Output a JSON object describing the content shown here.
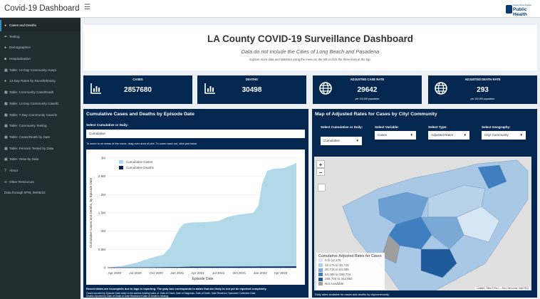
{
  "app": {
    "title": "Covid-19 Dashboard",
    "menu_icon": "hamburger-icon",
    "logo_top": "County of Los Angeles",
    "logo_main": "Public Health"
  },
  "sidebar": {
    "items": [
      {
        "label": "Cases and Deaths",
        "icon": "dashboard-icon"
      },
      {
        "label": "Testing",
        "icon": "syringe-icon"
      },
      {
        "label": "Demographics",
        "icon": "users-icon"
      },
      {
        "label": "Hospitalization",
        "icon": "hospital-icon"
      },
      {
        "label": "Table: 14-Day Community Hospi",
        "icon": "table-icon"
      },
      {
        "label": "14-Day Rates by Race/Ethnicity",
        "icon": "users-icon"
      },
      {
        "label": "Table: Community Case/Death",
        "icon": "table-icon"
      },
      {
        "label": "Table: 14-Day Community Case/D",
        "icon": "table-icon"
      },
      {
        "label": "Table: 7-Day Community Case/D",
        "icon": "table-icon"
      },
      {
        "label": "Table: Community Testing",
        "icon": "table-icon"
      },
      {
        "label": "Table: Cases/Death by Date",
        "icon": "table-icon"
      },
      {
        "label": "Table: Persons Tested by Date",
        "icon": "table-icon"
      },
      {
        "label": "Table: Tests by Date",
        "icon": "table-icon"
      },
      {
        "label": "About",
        "icon": "question-icon"
      },
      {
        "label": "Other Resources",
        "icon": "link-icon"
      }
    ],
    "note": "Data through 6PM, 06/08/22"
  },
  "header": {
    "title": "LA County COVID-19 Surveillance Dashboard",
    "subtitle": "Data do not include the Cities of Long Beach and Pasadena",
    "explore": "Explore more data and statistics using the menu on the left or click the three lines at the top."
  },
  "stats": [
    {
      "label": "CASES",
      "value": "2857680",
      "sub": "",
      "icon": "chart-icon"
    },
    {
      "label": "DEATHS",
      "value": "30498",
      "sub": "",
      "icon": "chart-icon"
    },
    {
      "label": "ADJUSTED CASE RATE",
      "value": "29642",
      "sub": "per 100,000 population",
      "icon": "globe-icon"
    },
    {
      "label": "ADJUSTED DEATH RATE",
      "value": "293",
      "sub": "per 100,000 population",
      "icon": "globe-icon"
    }
  ],
  "left_panel": {
    "title": "Cumulative Cases and Deaths by Episode Date",
    "select_label": "Select Cumulative or Daily:",
    "select_value": "Cumulative",
    "hint": "To zoom in on areas of the curve, drag over area of plot. To zoom back out, click plot twice.",
    "note1": "Recent dates are incomplete due to lags in reporting. The gray box corresponds to dates that are likely to not yet be reported completely.",
    "note2": "Cases reported by Episode Date which is the earliest existing value of: Date of Onset, Date of Diagnosis, Date of Death, Date Received, Specimen Collection Date.",
    "note3": "Deaths reported by Date of Death or Date Received if Date of Death is missing."
  },
  "chart_data": {
    "type": "area",
    "title": "",
    "xlabel": "Episode Date",
    "ylabel": "Cumulative Cases and Deaths, by Episode Date",
    "x_ticks": [
      "Apr 2020",
      "Jul 2020",
      "Oct 2020",
      "Jan 2021",
      "Apr 2021",
      "Jul 2021",
      "Oct 2021",
      "Jan 2022",
      "Apr 2022"
    ],
    "y_ticks": [
      "0",
      "0.5M",
      "1M",
      "1.5M",
      "2M",
      "2.5M",
      "3M"
    ],
    "ylim": [
      0,
      3000000
    ],
    "legend": "top-left",
    "grid": true,
    "series": [
      {
        "name": "Cumulative Cases",
        "color": "#add8e6",
        "x": [
          "2020-03-01",
          "2020-05-01",
          "2020-07-01",
          "2020-09-01",
          "2020-11-01",
          "2020-12-01",
          "2021-01-01",
          "2021-01-15",
          "2021-02-01",
          "2021-03-01",
          "2021-05-01",
          "2021-07-01",
          "2021-08-15",
          "2021-10-01",
          "2021-12-01",
          "2021-12-25",
          "2022-01-10",
          "2022-02-01",
          "2022-03-01",
          "2022-04-15",
          "2022-05-15",
          "2022-06-08"
        ],
        "values": [
          0,
          40000,
          120000,
          250000,
          350000,
          550000,
          950000,
          1100000,
          1200000,
          1230000,
          1240000,
          1270000,
          1390000,
          1450000,
          1490000,
          1700000,
          2300000,
          2650000,
          2700000,
          2720000,
          2790000,
          2857680
        ]
      },
      {
        "name": "Cumulative Deaths",
        "color": "#0b1f5c",
        "x": [
          "2020-03-01",
          "2020-09-01",
          "2021-01-01",
          "2021-03-01",
          "2021-10-01",
          "2022-02-01",
          "2022-06-08"
        ],
        "values": [
          0,
          6500,
          13000,
          22000,
          26000,
          29000,
          30498
        ]
      }
    ]
  },
  "right_panel": {
    "title": "Map of Adjusted Rates for Cases by City/ Community",
    "select1_label": "Select Cumulative or Daily:",
    "select1_value": "Cumulative",
    "select2_label": "Select Variable:",
    "select2_value": "Cases",
    "select3_label": "Select Type:",
    "select3_value": "Adjusted Rates",
    "select4_label": "Select Geography:",
    "select4_value": "City/ Community",
    "zoom_in": "+",
    "zoom_out": "−",
    "legend_title": "Cumulative Adjusted Rates for Cases",
    "legend": [
      {
        "label": "0 to 12,175",
        "color": "#d6e6f5"
      },
      {
        "label": "12,175 to 30,715",
        "color": "#b1cde6"
      },
      {
        "label": "30,715 to 64,495",
        "color": "#7aa9d6"
      },
      {
        "label": "64,495 to 288,704",
        "color": "#3f7fc0"
      },
      {
        "label": "288,704 to 342,852",
        "color": "#1f5a9b"
      },
      {
        "label": "Not Available",
        "color": "#9e9e9e"
      }
    ],
    "attribution": "Leaflet | Tiles © Esri — Esri, DeLorme, NAVTEQ",
    "footer": "Daily rates available for cases and deaths by city/community"
  }
}
